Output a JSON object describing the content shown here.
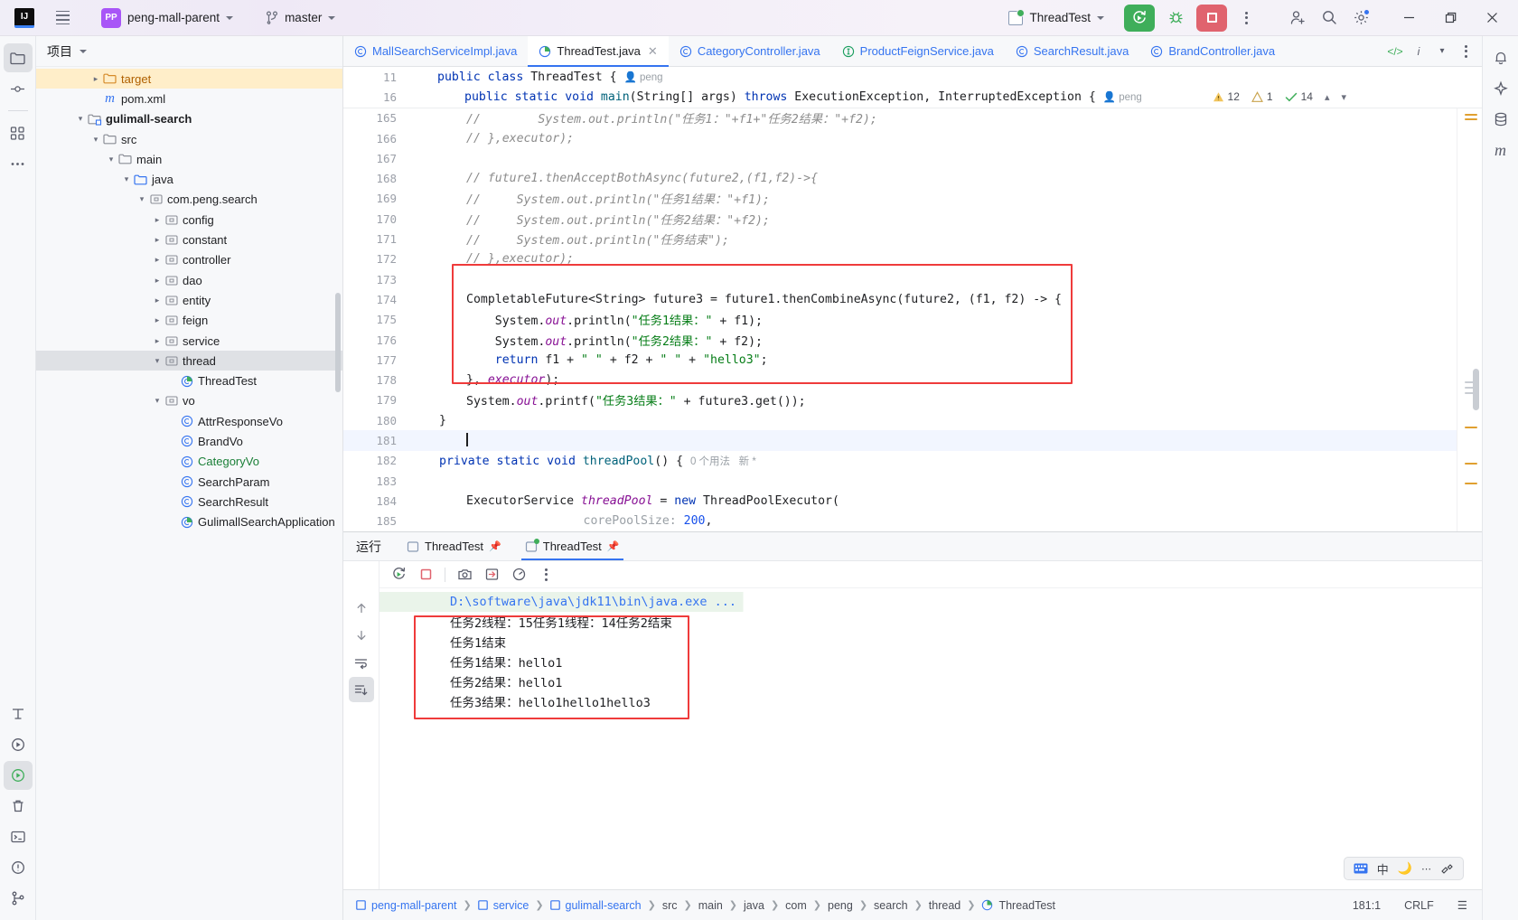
{
  "titlebar": {
    "logo": "IJ",
    "menu_icon": "hamburger-menu-icon",
    "project_badge": "PP",
    "project_name": "peng-mall-parent",
    "branch_icon": "git-branch-icon",
    "branch_name": "master",
    "run_config": "ThreadTest",
    "run_button": "run-icon",
    "debug_button": "debug-bug-icon",
    "stop_button": "stop-icon",
    "more_button": "more-vertical-icon",
    "account_icon": "add-account-icon",
    "search_icon": "search-icon",
    "settings_icon": "settings-gear-icon",
    "minimize": "minimize-icon",
    "maximize": "maximize-icon",
    "close": "close-icon"
  },
  "left_rail": {
    "items": [
      {
        "name": "project-tool-icon",
        "glyph": "folder"
      },
      {
        "name": "commit-tool-icon",
        "glyph": "commit"
      },
      {
        "name": "structure-tool-icon",
        "glyph": "structure"
      },
      {
        "name": "more-tool-icon",
        "glyph": "dots"
      }
    ],
    "bottom": [
      {
        "name": "terminal-tool-icon"
      },
      {
        "name": "run-tool-icon"
      },
      {
        "name": "services-tool-icon"
      },
      {
        "name": "problems-tool-icon"
      },
      {
        "name": "version-control-tool-icon"
      }
    ]
  },
  "project_panel": {
    "title": "项目",
    "tree": [
      {
        "indent": 3,
        "arrow": "right",
        "icon": "folder-orange",
        "label": "target",
        "style": "orange",
        "state": "highlight-yellow"
      },
      {
        "indent": 3,
        "arrow": "none",
        "icon": "maven-m",
        "label": "pom.xml",
        "style": "plain",
        "state": ""
      },
      {
        "indent": 2,
        "arrow": "down",
        "icon": "module",
        "label": "gulimall-search",
        "style": "bold",
        "state": ""
      },
      {
        "indent": 3,
        "arrow": "down",
        "icon": "folder",
        "label": "src",
        "style": "plain",
        "state": ""
      },
      {
        "indent": 4,
        "arrow": "down",
        "icon": "folder",
        "label": "main",
        "style": "plain",
        "state": ""
      },
      {
        "indent": 5,
        "arrow": "down",
        "icon": "folder-blue",
        "label": "java",
        "style": "plain",
        "state": ""
      },
      {
        "indent": 6,
        "arrow": "down",
        "icon": "package",
        "label": "com.peng.search",
        "style": "plain",
        "state": ""
      },
      {
        "indent": 7,
        "arrow": "right",
        "icon": "package",
        "label": "config",
        "style": "plain",
        "state": ""
      },
      {
        "indent": 7,
        "arrow": "right",
        "icon": "package",
        "label": "constant",
        "style": "plain",
        "state": ""
      },
      {
        "indent": 7,
        "arrow": "right",
        "icon": "package",
        "label": "controller",
        "style": "plain",
        "state": ""
      },
      {
        "indent": 7,
        "arrow": "right",
        "icon": "package",
        "label": "dao",
        "style": "plain",
        "state": ""
      },
      {
        "indent": 7,
        "arrow": "right",
        "icon": "package",
        "label": "entity",
        "style": "plain",
        "state": ""
      },
      {
        "indent": 7,
        "arrow": "right",
        "icon": "package",
        "label": "feign",
        "style": "plain",
        "state": ""
      },
      {
        "indent": 7,
        "arrow": "right",
        "icon": "package",
        "label": "service",
        "style": "plain",
        "state": ""
      },
      {
        "indent": 7,
        "arrow": "down",
        "icon": "package",
        "label": "thread",
        "style": "plain",
        "state": "highlight-gray"
      },
      {
        "indent": 8,
        "arrow": "none",
        "icon": "class-run",
        "label": "ThreadTest",
        "style": "plain",
        "state": ""
      },
      {
        "indent": 7,
        "arrow": "down",
        "icon": "package",
        "label": "vo",
        "style": "plain",
        "state": ""
      },
      {
        "indent": 8,
        "arrow": "none",
        "icon": "class",
        "label": "AttrResponseVo",
        "style": "plain",
        "state": ""
      },
      {
        "indent": 8,
        "arrow": "none",
        "icon": "class",
        "label": "BrandVo",
        "style": "plain",
        "state": ""
      },
      {
        "indent": 8,
        "arrow": "none",
        "icon": "class",
        "label": "CategoryVo",
        "style": "green",
        "state": ""
      },
      {
        "indent": 8,
        "arrow": "none",
        "icon": "class",
        "label": "SearchParam",
        "style": "plain",
        "state": ""
      },
      {
        "indent": 8,
        "arrow": "none",
        "icon": "class",
        "label": "SearchResult",
        "style": "plain",
        "state": ""
      },
      {
        "indent": 8,
        "arrow": "none",
        "icon": "class-run",
        "label": "GulimallSearchApplication",
        "style": "plain",
        "state": ""
      }
    ]
  },
  "editor_tabs": {
    "tabs": [
      {
        "icon": "java-class-icon",
        "label": "MallSearchServiceImpl.java",
        "active": false,
        "closable": false
      },
      {
        "icon": "java-runnable-class-icon",
        "label": "ThreadTest.java",
        "active": true,
        "closable": true
      },
      {
        "icon": "java-class-icon",
        "label": "CategoryController.java",
        "active": false,
        "closable": false
      },
      {
        "icon": "java-interface-icon",
        "label": "ProductFeignService.java",
        "active": false,
        "closable": false
      },
      {
        "icon": "java-class-icon",
        "label": "SearchResult.java",
        "active": false,
        "closable": false
      },
      {
        "icon": "java-class-icon",
        "label": "BrandController.java",
        "active": false,
        "closable": false
      }
    ],
    "right_actions": [
      "code-preview-icon",
      "inline-hint-icon",
      "chevron-down-icon",
      "more-vertical-icon"
    ]
  },
  "inspections": {
    "warnings": "12",
    "weak_warnings": "1",
    "checks": "14",
    "up_icon": "chevron-up-icon",
    "down_icon": "chevron-down-icon"
  },
  "sticky_lines": [
    {
      "num": "11",
      "indent": 1,
      "html_key": "sticky_0",
      "hint": "peng"
    },
    {
      "num": "16",
      "indent": 2,
      "html_key": "sticky_1",
      "hint": "peng"
    }
  ],
  "code": {
    "sticky_0_tokens": [
      {
        "t": "public",
        "c": "kw"
      },
      {
        "t": " ",
        "c": "id"
      },
      {
        "t": "class",
        "c": "kw"
      },
      {
        "t": " ThreadTest {",
        "c": "id"
      }
    ],
    "sticky_1_tokens": [
      {
        "t": "public",
        "c": "kw"
      },
      {
        "t": " ",
        "c": "id"
      },
      {
        "t": "static",
        "c": "kw"
      },
      {
        "t": " ",
        "c": "id"
      },
      {
        "t": "void",
        "c": "kw"
      },
      {
        "t": " ",
        "c": "id"
      },
      {
        "t": "main",
        "c": "mth"
      },
      {
        "t": "(String[] args) ",
        "c": "id"
      },
      {
        "t": "throws",
        "c": "kw"
      },
      {
        "t": " ExecutionException, InterruptedException {",
        "c": "id"
      }
    ],
    "lines": [
      {
        "num": "165",
        "clipped": true,
        "tokens": [
          {
            "t": "//        System.out.println(\"任务1：\"+f1+\"任务2结果：\"+f2);",
            "c": "cmt"
          }
        ]
      },
      {
        "num": "166",
        "tokens": [
          {
            "t": "// },executor);",
            "c": "cmt"
          }
        ]
      },
      {
        "num": "167",
        "tokens": []
      },
      {
        "num": "168",
        "tokens": [
          {
            "t": "// future1.thenAcceptBothAsync(future2,(f1,f2)->{",
            "c": "cmt"
          }
        ]
      },
      {
        "num": "169",
        "tokens": [
          {
            "t": "//     System.out.println(\"任务1结果：\"+f1);",
            "c": "cmt"
          }
        ]
      },
      {
        "num": "170",
        "tokens": [
          {
            "t": "//     System.out.println(\"任务2结果：\"+f2);",
            "c": "cmt"
          }
        ]
      },
      {
        "num": "171",
        "tokens": [
          {
            "t": "//     System.out.println(\"任务结束\");",
            "c": "cmt"
          }
        ]
      },
      {
        "num": "172",
        "tokens": [
          {
            "t": "// },executor);",
            "c": "cmt"
          }
        ]
      },
      {
        "num": "173",
        "tokens": []
      },
      {
        "num": "174",
        "tokens": [
          {
            "t": "CompletableFuture<String> future3 = future1.thenCombineAsync(future2, (f1, f2) -> {",
            "c": "id"
          }
        ]
      },
      {
        "num": "175",
        "tokens": [
          {
            "t": "    System.",
            "c": "id"
          },
          {
            "t": "out",
            "c": "fld"
          },
          {
            "t": ".println(",
            "c": "id"
          },
          {
            "t": "\"任务1结果：\"",
            "c": "str"
          },
          {
            "t": " + f1);",
            "c": "id"
          }
        ]
      },
      {
        "num": "176",
        "tokens": [
          {
            "t": "    System.",
            "c": "id"
          },
          {
            "t": "out",
            "c": "fld"
          },
          {
            "t": ".println(",
            "c": "id"
          },
          {
            "t": "\"任务2结果：\"",
            "c": "str"
          },
          {
            "t": " + f2);",
            "c": "id"
          }
        ]
      },
      {
        "num": "177",
        "tokens": [
          {
            "t": "    ",
            "c": "id"
          },
          {
            "t": "return",
            "c": "kw"
          },
          {
            "t": " f1 + ",
            "c": "id"
          },
          {
            "t": "\" \"",
            "c": "str"
          },
          {
            "t": " + f2 + ",
            "c": "id"
          },
          {
            "t": "\" \"",
            "c": "str"
          },
          {
            "t": " + ",
            "c": "id"
          },
          {
            "t": "\"hello3\"",
            "c": "str"
          },
          {
            "t": ";",
            "c": "id"
          }
        ]
      },
      {
        "num": "178",
        "tokens": [
          {
            "t": "}, ",
            "c": "id"
          },
          {
            "t": "executor",
            "c": "fld"
          },
          {
            "t": ");",
            "c": "id"
          }
        ]
      },
      {
        "num": "179",
        "tokens": [
          {
            "t": "System.",
            "c": "id"
          },
          {
            "t": "out",
            "c": "fld"
          },
          {
            "t": ".printf(",
            "c": "id"
          },
          {
            "t": "\"任务3结果：\"",
            "c": "str"
          },
          {
            "t": " + future3.get());",
            "c": "id"
          }
        ]
      },
      {
        "num": "180",
        "tokens": [
          {
            "t": "}",
            "c": "id"
          }
        ],
        "dedent": true
      },
      {
        "num": "181",
        "tokens": [],
        "caret": true,
        "current": true
      },
      {
        "num": "182",
        "tokens": [
          {
            "t": "private",
            "c": "kw"
          },
          {
            "t": " ",
            "c": "id"
          },
          {
            "t": "static",
            "c": "kw"
          },
          {
            "t": " ",
            "c": "id"
          },
          {
            "t": "void",
            "c": "kw"
          },
          {
            "t": " ",
            "c": "id"
          },
          {
            "t": "threadPool",
            "c": "mth"
          },
          {
            "t": "() {",
            "c": "id"
          }
        ],
        "dedent": true,
        "hint": "0 个用法   新 *"
      },
      {
        "num": "183",
        "tokens": []
      },
      {
        "num": "184",
        "tokens": [
          {
            "t": "ExecutorService ",
            "c": "id"
          },
          {
            "t": "threadPool",
            "c": "fld"
          },
          {
            "t": " = ",
            "c": "id"
          },
          {
            "t": "new",
            "c": "kw"
          },
          {
            "t": " ThreadPoolExecutor(",
            "c": "id"
          }
        ]
      },
      {
        "num": "185",
        "tokens": [
          {
            "t": "        corePoolSize: ",
            "c": "gray"
          },
          {
            "t": "200",
            "c": "num"
          },
          {
            "t": ",",
            "c": "id"
          }
        ],
        "extra_indent": true
      }
    ]
  },
  "run_panel": {
    "title": "运行",
    "tabs": [
      {
        "icon": "run-config-icon",
        "label": "ThreadTest",
        "active": false,
        "pin": "pin-icon"
      },
      {
        "icon": "run-config-active-icon",
        "label": "ThreadTest",
        "active": true,
        "pin": "pin-icon"
      }
    ],
    "side_toolbar": [
      "rerun-icon",
      "stop-icon",
      "camera-icon",
      "export-icon",
      "profiler-icon",
      "more-vertical-icon"
    ],
    "left_toolbar": [
      "scroll-up-icon",
      "scroll-down-icon",
      "soft-wrap-icon",
      "scroll-to-end-icon"
    ],
    "console": {
      "command": "D:\\software\\java\\jdk11\\bin\\java.exe ...",
      "lines": [
        "任务2线程：15任务1线程：14任务2结束",
        "任务1结束",
        "任务1结果：hello1",
        "任务2结果：hello1",
        "任务3结果：hello1hello1hello3"
      ]
    }
  },
  "status_bar": {
    "breadcrumbs": [
      {
        "icon": "module-icon",
        "label": "peng-mall-parent",
        "link": true
      },
      {
        "icon": "module-icon",
        "label": "service",
        "link": true
      },
      {
        "icon": "module-icon",
        "label": "gulimall-search",
        "link": true
      },
      {
        "icon": "",
        "label": "src",
        "link": false
      },
      {
        "icon": "",
        "label": "main",
        "link": false
      },
      {
        "icon": "",
        "label": "java",
        "link": false
      },
      {
        "icon": "",
        "label": "com",
        "link": false
      },
      {
        "icon": "",
        "label": "peng",
        "link": false
      },
      {
        "icon": "",
        "label": "search",
        "link": false
      },
      {
        "icon": "",
        "label": "thread",
        "link": false
      },
      {
        "icon": "class-run-icon",
        "label": "ThreadTest",
        "link": false
      }
    ],
    "caret_position": "181:1",
    "line_separator": "CRLF"
  },
  "right_rail": {
    "items": [
      "notifications-bell-icon",
      "ai-assistant-icon",
      "database-icon",
      "maven-icon"
    ]
  },
  "ime": {
    "keyboard_icon": "keyboard-icon",
    "mode": "中",
    "moon_icon": "moon-icon",
    "dots": "⋯",
    "tools": "settings"
  },
  "colors": {
    "accent": "#3574f0",
    "run_green": "#3fae5a",
    "stop_red": "#e0636e",
    "highlight_box": "#ef3b3b",
    "selection_yellow": "#ffeec9",
    "selection_gray": "#dfe1e5",
    "string_green": "#067d17",
    "keyword_blue": "#0033b3",
    "comment_gray": "#8c8c8c",
    "field_purple": "#871094"
  }
}
